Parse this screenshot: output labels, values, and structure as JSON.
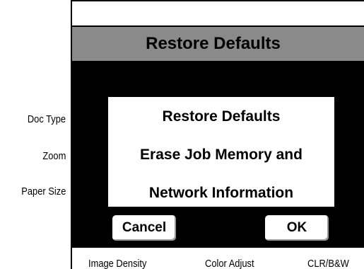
{
  "side_labels": {
    "doc_type": "Doc Type",
    "zoom": "Zoom",
    "paper_size": "Paper Size"
  },
  "header": {
    "title": "Restore Defaults"
  },
  "dialog": {
    "line1": "Restore Defaults",
    "line2": "Erase Job Memory and",
    "line3": "Network Information",
    "cancel_label": "Cancel",
    "ok_label": "OK"
  },
  "bottom_labels": {
    "image_density": "Image Density",
    "color_adjust": "Color Adjust",
    "clr_bw": "CLR/B&W"
  },
  "colors": {
    "title_bar": "#8a8a8a",
    "panel": "#000000",
    "dialog": "#ffffff"
  }
}
